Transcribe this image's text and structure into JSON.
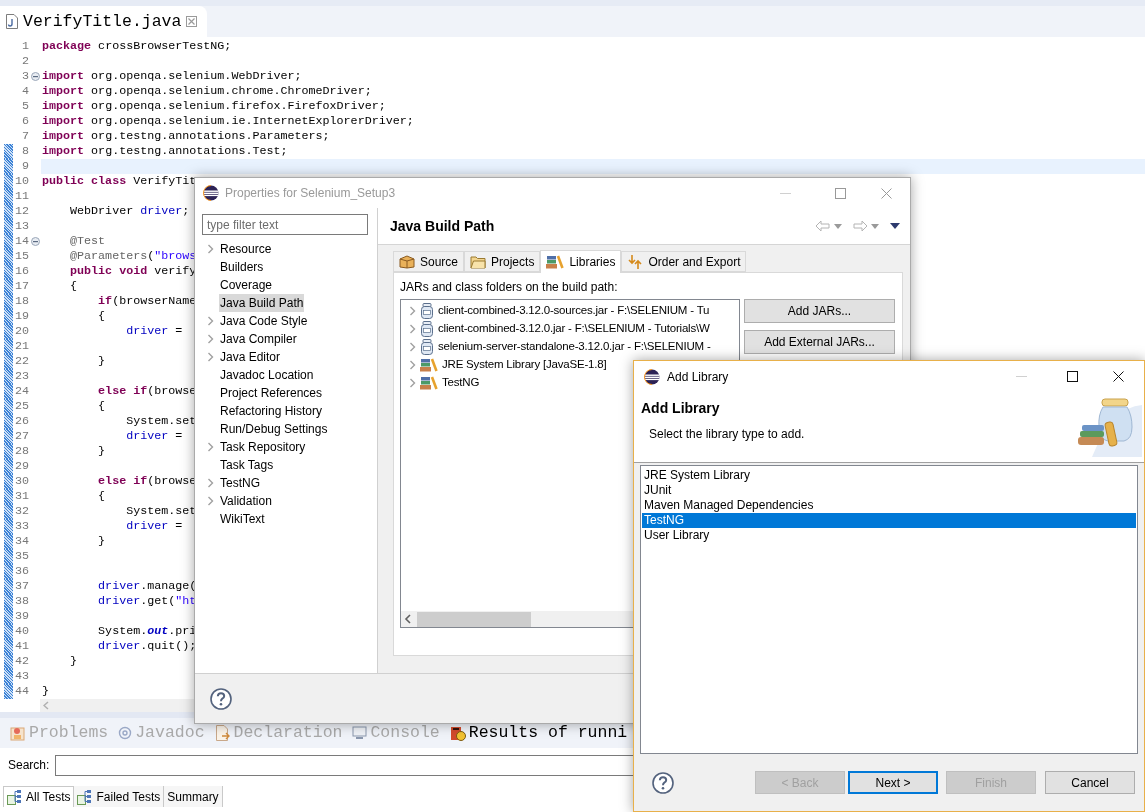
{
  "editor": {
    "tab": {
      "title": "VerifyTitle.java"
    },
    "lines": [
      {
        "number": "1",
        "changed": false,
        "current": false,
        "fold": false,
        "tokens": [
          {
            "kind": "keyword",
            "text": "package"
          },
          {
            "kind": "plain",
            "text": " crossBrowserTestNG;"
          }
        ]
      },
      {
        "number": "2",
        "changed": false,
        "current": false,
        "fold": false
      },
      {
        "number": "3",
        "changed": false,
        "current": false,
        "fold": true,
        "tokens": [
          {
            "kind": "keyword",
            "text": "import"
          },
          {
            "kind": "plain",
            "text": " org.openqa.selenium.WebDriver;"
          }
        ]
      },
      {
        "number": "4",
        "changed": false,
        "current": false,
        "fold": false,
        "tokens": [
          {
            "kind": "keyword",
            "text": "import"
          },
          {
            "kind": "plain",
            "text": " org.openqa.selenium.chrome.ChromeDriver;"
          }
        ]
      },
      {
        "number": "5",
        "changed": false,
        "current": false,
        "fold": false,
        "tokens": [
          {
            "kind": "keyword",
            "text": "import"
          },
          {
            "kind": "plain",
            "text": " org.openqa.selenium.firefox.FirefoxDriver;"
          }
        ]
      },
      {
        "number": "6",
        "changed": false,
        "current": false,
        "fold": false,
        "tokens": [
          {
            "kind": "keyword",
            "text": "import"
          },
          {
            "kind": "plain",
            "text": " org.openqa.selenium.ie.InternetExplorerDriver;"
          }
        ]
      },
      {
        "number": "7",
        "changed": false,
        "current": false,
        "fold": false,
        "tokens": [
          {
            "kind": "keyword",
            "text": "import"
          },
          {
            "kind": "plain",
            "text": " org.testng.annotations.Parameters;"
          }
        ]
      },
      {
        "number": "8",
        "changed": true,
        "current": false,
        "fold": false,
        "tokens": [
          {
            "kind": "keyword",
            "text": "import"
          },
          {
            "kind": "plain",
            "text": " org.testng.annotations.Test;"
          }
        ]
      },
      {
        "number": "9",
        "changed": true,
        "current": true,
        "fold": false
      },
      {
        "number": "10",
        "changed": true,
        "current": false,
        "fold": false,
        "tokens": [
          {
            "kind": "keyword",
            "text": "public class"
          },
          {
            "kind": "plain",
            "text": " VerifyTit"
          }
        ]
      },
      {
        "number": "11",
        "changed": true,
        "current": false,
        "fold": false
      },
      {
        "number": "12",
        "changed": true,
        "current": false,
        "fold": false,
        "tokens": [
          {
            "kind": "plain",
            "text": "    WebDriver "
          },
          {
            "kind": "field",
            "text": "driver"
          },
          {
            "kind": "plain",
            "text": ";"
          }
        ]
      },
      {
        "number": "13",
        "changed": true,
        "current": false,
        "fold": false
      },
      {
        "number": "14",
        "changed": true,
        "current": false,
        "fold": true,
        "tokens": [
          {
            "kind": "annotation",
            "text": "    @Test"
          }
        ]
      },
      {
        "number": "15",
        "changed": true,
        "current": false,
        "fold": false,
        "tokens": [
          {
            "kind": "annotation",
            "text": "    @Parameters"
          },
          {
            "kind": "plain",
            "text": "("
          },
          {
            "kind": "string",
            "text": "\"brows"
          }
        ]
      },
      {
        "number": "16",
        "changed": true,
        "current": false,
        "fold": false,
        "tokens": [
          {
            "kind": "keyword",
            "text": "    public void"
          },
          {
            "kind": "plain",
            "text": " verify"
          }
        ]
      },
      {
        "number": "17",
        "changed": true,
        "current": false,
        "fold": false,
        "tokens": [
          {
            "kind": "plain",
            "text": "    {"
          }
        ]
      },
      {
        "number": "18",
        "changed": true,
        "current": false,
        "fold": false,
        "tokens": [
          {
            "kind": "keyword",
            "text": "        if"
          },
          {
            "kind": "plain",
            "text": "(browserName"
          }
        ]
      },
      {
        "number": "19",
        "changed": true,
        "current": false,
        "fold": false,
        "tokens": [
          {
            "kind": "plain",
            "text": "        {"
          }
        ]
      },
      {
        "number": "20",
        "changed": true,
        "current": false,
        "fold": false,
        "tokens": [
          {
            "kind": "field",
            "text": "            driver"
          },
          {
            "kind": "plain",
            "text": " ="
          }
        ]
      },
      {
        "number": "21",
        "changed": true,
        "current": false,
        "fold": false
      },
      {
        "number": "22",
        "changed": true,
        "current": false,
        "fold": false,
        "tokens": [
          {
            "kind": "plain",
            "text": "        }"
          }
        ]
      },
      {
        "number": "23",
        "changed": true,
        "current": false,
        "fold": false
      },
      {
        "number": "24",
        "changed": true,
        "current": false,
        "fold": false,
        "tokens": [
          {
            "kind": "keyword",
            "text": "        else if"
          },
          {
            "kind": "plain",
            "text": "(browse"
          }
        ]
      },
      {
        "number": "25",
        "changed": true,
        "current": false,
        "fold": false,
        "tokens": [
          {
            "kind": "plain",
            "text": "        {"
          }
        ]
      },
      {
        "number": "26",
        "changed": true,
        "current": false,
        "fold": false,
        "tokens": [
          {
            "kind": "plain",
            "text": "            System.set"
          }
        ]
      },
      {
        "number": "27",
        "changed": true,
        "current": false,
        "fold": false,
        "tokens": [
          {
            "kind": "field",
            "text": "            driver"
          },
          {
            "kind": "plain",
            "text": " ="
          }
        ]
      },
      {
        "number": "28",
        "changed": true,
        "current": false,
        "fold": false,
        "tokens": [
          {
            "kind": "plain",
            "text": "        }"
          }
        ]
      },
      {
        "number": "29",
        "changed": true,
        "current": false,
        "fold": false
      },
      {
        "number": "30",
        "changed": true,
        "current": false,
        "fold": false,
        "tokens": [
          {
            "kind": "keyword",
            "text": "        else if"
          },
          {
            "kind": "plain",
            "text": "(browse"
          }
        ]
      },
      {
        "number": "31",
        "changed": true,
        "current": false,
        "fold": false,
        "tokens": [
          {
            "kind": "plain",
            "text": "        {"
          }
        ]
      },
      {
        "number": "32",
        "changed": true,
        "current": false,
        "fold": false,
        "tokens": [
          {
            "kind": "plain",
            "text": "            System.set"
          }
        ]
      },
      {
        "number": "33",
        "changed": true,
        "current": false,
        "fold": false,
        "tokens": [
          {
            "kind": "field",
            "text": "            driver"
          },
          {
            "kind": "plain",
            "text": " ="
          }
        ]
      },
      {
        "number": "34",
        "changed": true,
        "current": false,
        "fold": false,
        "tokens": [
          {
            "kind": "plain",
            "text": "        }"
          }
        ]
      },
      {
        "number": "35",
        "changed": true,
        "current": false,
        "fold": false
      },
      {
        "number": "36",
        "changed": true,
        "current": false,
        "fold": false
      },
      {
        "number": "37",
        "changed": true,
        "current": false,
        "fold": false,
        "tokens": [
          {
            "kind": "field",
            "text": "        driver"
          },
          {
            "kind": "plain",
            "text": ".manage("
          }
        ]
      },
      {
        "number": "38",
        "changed": true,
        "current": false,
        "fold": false,
        "tokens": [
          {
            "kind": "field",
            "text": "        driver"
          },
          {
            "kind": "plain",
            "text": ".get("
          },
          {
            "kind": "string",
            "text": "\"ht"
          }
        ]
      },
      {
        "number": "39",
        "changed": true,
        "current": false,
        "fold": false
      },
      {
        "number": "40",
        "changed": true,
        "current": false,
        "fold": false,
        "tokens": [
          {
            "kind": "plain",
            "text": "        System."
          },
          {
            "kind": "static_field",
            "text": "out"
          },
          {
            "kind": "plain",
            "text": ".pri"
          }
        ]
      },
      {
        "number": "41",
        "changed": true,
        "current": false,
        "fold": false,
        "tokens": [
          {
            "kind": "field",
            "text": "        driver"
          },
          {
            "kind": "plain",
            "text": ".quit();"
          }
        ]
      },
      {
        "number": "42",
        "changed": true,
        "current": false,
        "fold": false,
        "tokens": [
          {
            "kind": "plain",
            "text": "    }"
          }
        ]
      },
      {
        "number": "43",
        "changed": true,
        "current": false,
        "fold": false
      },
      {
        "number": "44",
        "changed": true,
        "current": false,
        "fold": false,
        "tokens": [
          {
            "kind": "plain",
            "text": "}"
          }
        ]
      }
    ]
  },
  "views": {
    "tabs": [
      {
        "label": "Problems",
        "kind": "problems",
        "selected": false
      },
      {
        "label": "Javadoc",
        "kind": "javadoc",
        "selected": false
      },
      {
        "label": "Declaration",
        "kind": "declaration",
        "selected": false
      },
      {
        "label": "Console",
        "kind": "console",
        "selected": false
      },
      {
        "label": "Results of runni",
        "kind": "testng",
        "selected": true
      }
    ],
    "search": {
      "label": "Search:"
    },
    "test_tabs": [
      {
        "label": "All Tests",
        "kind": "all",
        "selected": true
      },
      {
        "label": "Failed Tests",
        "kind": "failed",
        "selected": false
      },
      {
        "label": "Summary",
        "kind": "plain",
        "selected": false
      }
    ]
  },
  "properties_dialog": {
    "title": "Properties for Selenium_Setup3",
    "filter": {
      "placeholder": "type filter text"
    },
    "tree": [
      {
        "label": "Resource",
        "expandable": true,
        "selected": false
      },
      {
        "label": "Builders",
        "expandable": false,
        "selected": false
      },
      {
        "label": "Coverage",
        "expandable": false,
        "selected": false
      },
      {
        "label": "Java Build Path",
        "expandable": false,
        "selected": true
      },
      {
        "label": "Java Code Style",
        "expandable": true,
        "selected": false
      },
      {
        "label": "Java Compiler",
        "expandable": true,
        "selected": false
      },
      {
        "label": "Java Editor",
        "expandable": true,
        "selected": false
      },
      {
        "label": "Javadoc Location",
        "expandable": false,
        "selected": false
      },
      {
        "label": "Project References",
        "expandable": false,
        "selected": false
      },
      {
        "label": "Refactoring History",
        "expandable": false,
        "selected": false
      },
      {
        "label": "Run/Debug Settings",
        "expandable": false,
        "selected": false
      },
      {
        "label": "Task Repository",
        "expandable": true,
        "selected": false
      },
      {
        "label": "Task Tags",
        "expandable": false,
        "selected": false
      },
      {
        "label": "TestNG",
        "expandable": true,
        "selected": false
      },
      {
        "label": "Validation",
        "expandable": true,
        "selected": false
      },
      {
        "label": "WikiText",
        "expandable": false,
        "selected": false
      }
    ],
    "page_title": "Java Build Path",
    "tabs": [
      {
        "label": "Source",
        "kind": "source",
        "selected": false
      },
      {
        "label": "Projects",
        "kind": "projects",
        "selected": false
      },
      {
        "label": "Libraries",
        "kind": "libraries",
        "selected": true
      },
      {
        "label": "Order and Export",
        "kind": "order",
        "selected": false
      }
    ],
    "list_label": "JARs and class folders on the build path:",
    "entries": [
      {
        "label": "client-combined-3.12.0-sources.jar - F:\\SELENIUM - Tu",
        "kind": "jar"
      },
      {
        "label": "client-combined-3.12.0.jar - F:\\SELENIUM - Tutorials\\W",
        "kind": "jar"
      },
      {
        "label": "selenium-server-standalone-3.12.0.jar - F:\\SELENIUM -",
        "kind": "jar"
      },
      {
        "label": "JRE System Library [JavaSE-1.8]",
        "kind": "library"
      },
      {
        "label": "TestNG",
        "kind": "library"
      }
    ],
    "buttons": [
      "Add JARs...",
      "Add External JARs..."
    ]
  },
  "add_library_dialog": {
    "title": "Add Library",
    "heading": "Add Library",
    "description": "Select the library type to add.",
    "types": [
      {
        "label": "JRE System Library",
        "selected": false
      },
      {
        "label": "JUnit",
        "selected": false
      },
      {
        "label": "Maven Managed Dependencies",
        "selected": false
      },
      {
        "label": "TestNG",
        "selected": true
      },
      {
        "label": "User Library",
        "selected": false
      }
    ],
    "buttons": [
      {
        "label": "< Back",
        "disabled": true,
        "default": false
      },
      {
        "label": "Next >",
        "disabled": false,
        "default": true
      },
      {
        "label": "Finish",
        "disabled": true,
        "default": false
      },
      {
        "label": "Cancel",
        "disabled": false,
        "default": false
      }
    ]
  }
}
